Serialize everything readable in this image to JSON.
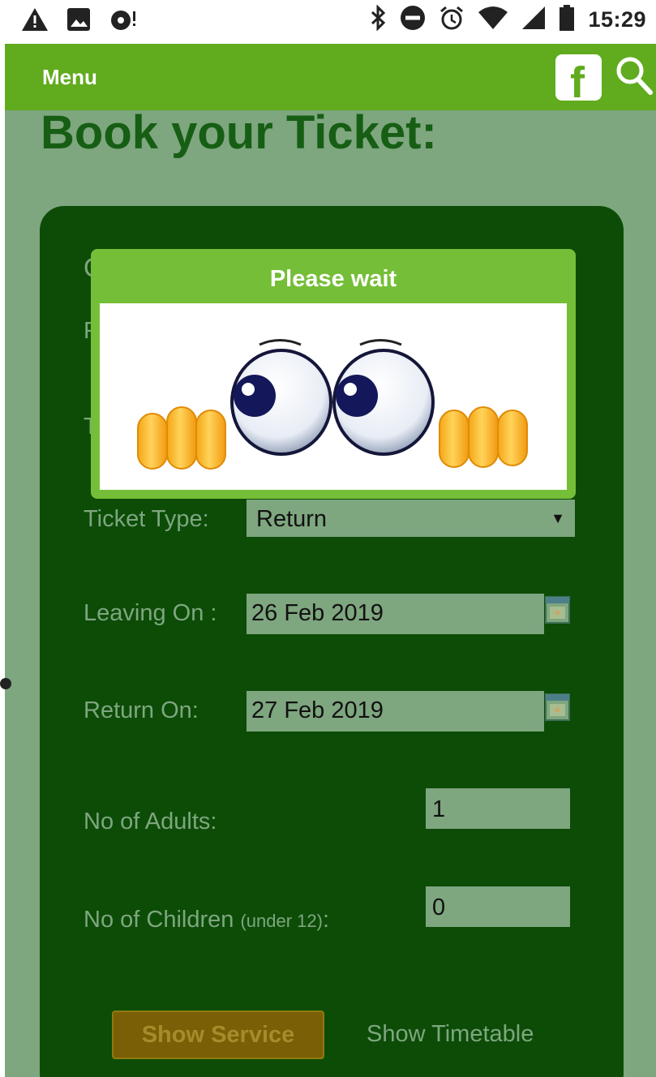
{
  "status_bar": {
    "time": "15:29",
    "left_icons": [
      "warning-icon",
      "image-icon",
      "sync-icon"
    ],
    "right_icons": [
      "bluetooth-icon",
      "do-not-disturb-icon",
      "alarm-icon",
      "wifi-icon",
      "signal-icon",
      "battery-icon"
    ]
  },
  "app_bar": {
    "menu_label": "Menu",
    "facebook_glyph": "f",
    "icons": [
      "facebook-icon",
      "search-icon"
    ],
    "background": "#60ab1e"
  },
  "page": {
    "title": "Book your Ticket:",
    "title_color": "#165e14",
    "background": "#7ea67f"
  },
  "form": {
    "partial_letters": [
      "C",
      "F",
      "T"
    ],
    "ticket_type": {
      "label": "Ticket Type:",
      "value": "Return",
      "arrow": "▼"
    },
    "leaving_on": {
      "label": "Leaving On :",
      "value": "26 Feb 2019"
    },
    "return_on": {
      "label": "Return On:",
      "value": "27 Feb 2019"
    },
    "adults": {
      "label": "No of Adults:",
      "value": "1"
    },
    "children": {
      "label": "No of Children",
      "note": "(under 12)",
      "suffix": ":",
      "value": "0"
    },
    "card_color": "#0c4c07"
  },
  "buttons": {
    "show_service": "Show Service",
    "show_timetable": "Show Timetable"
  },
  "modal": {
    "title": "Please wait",
    "background": "#75be37",
    "illustration": "waiting-eyes-icon"
  }
}
